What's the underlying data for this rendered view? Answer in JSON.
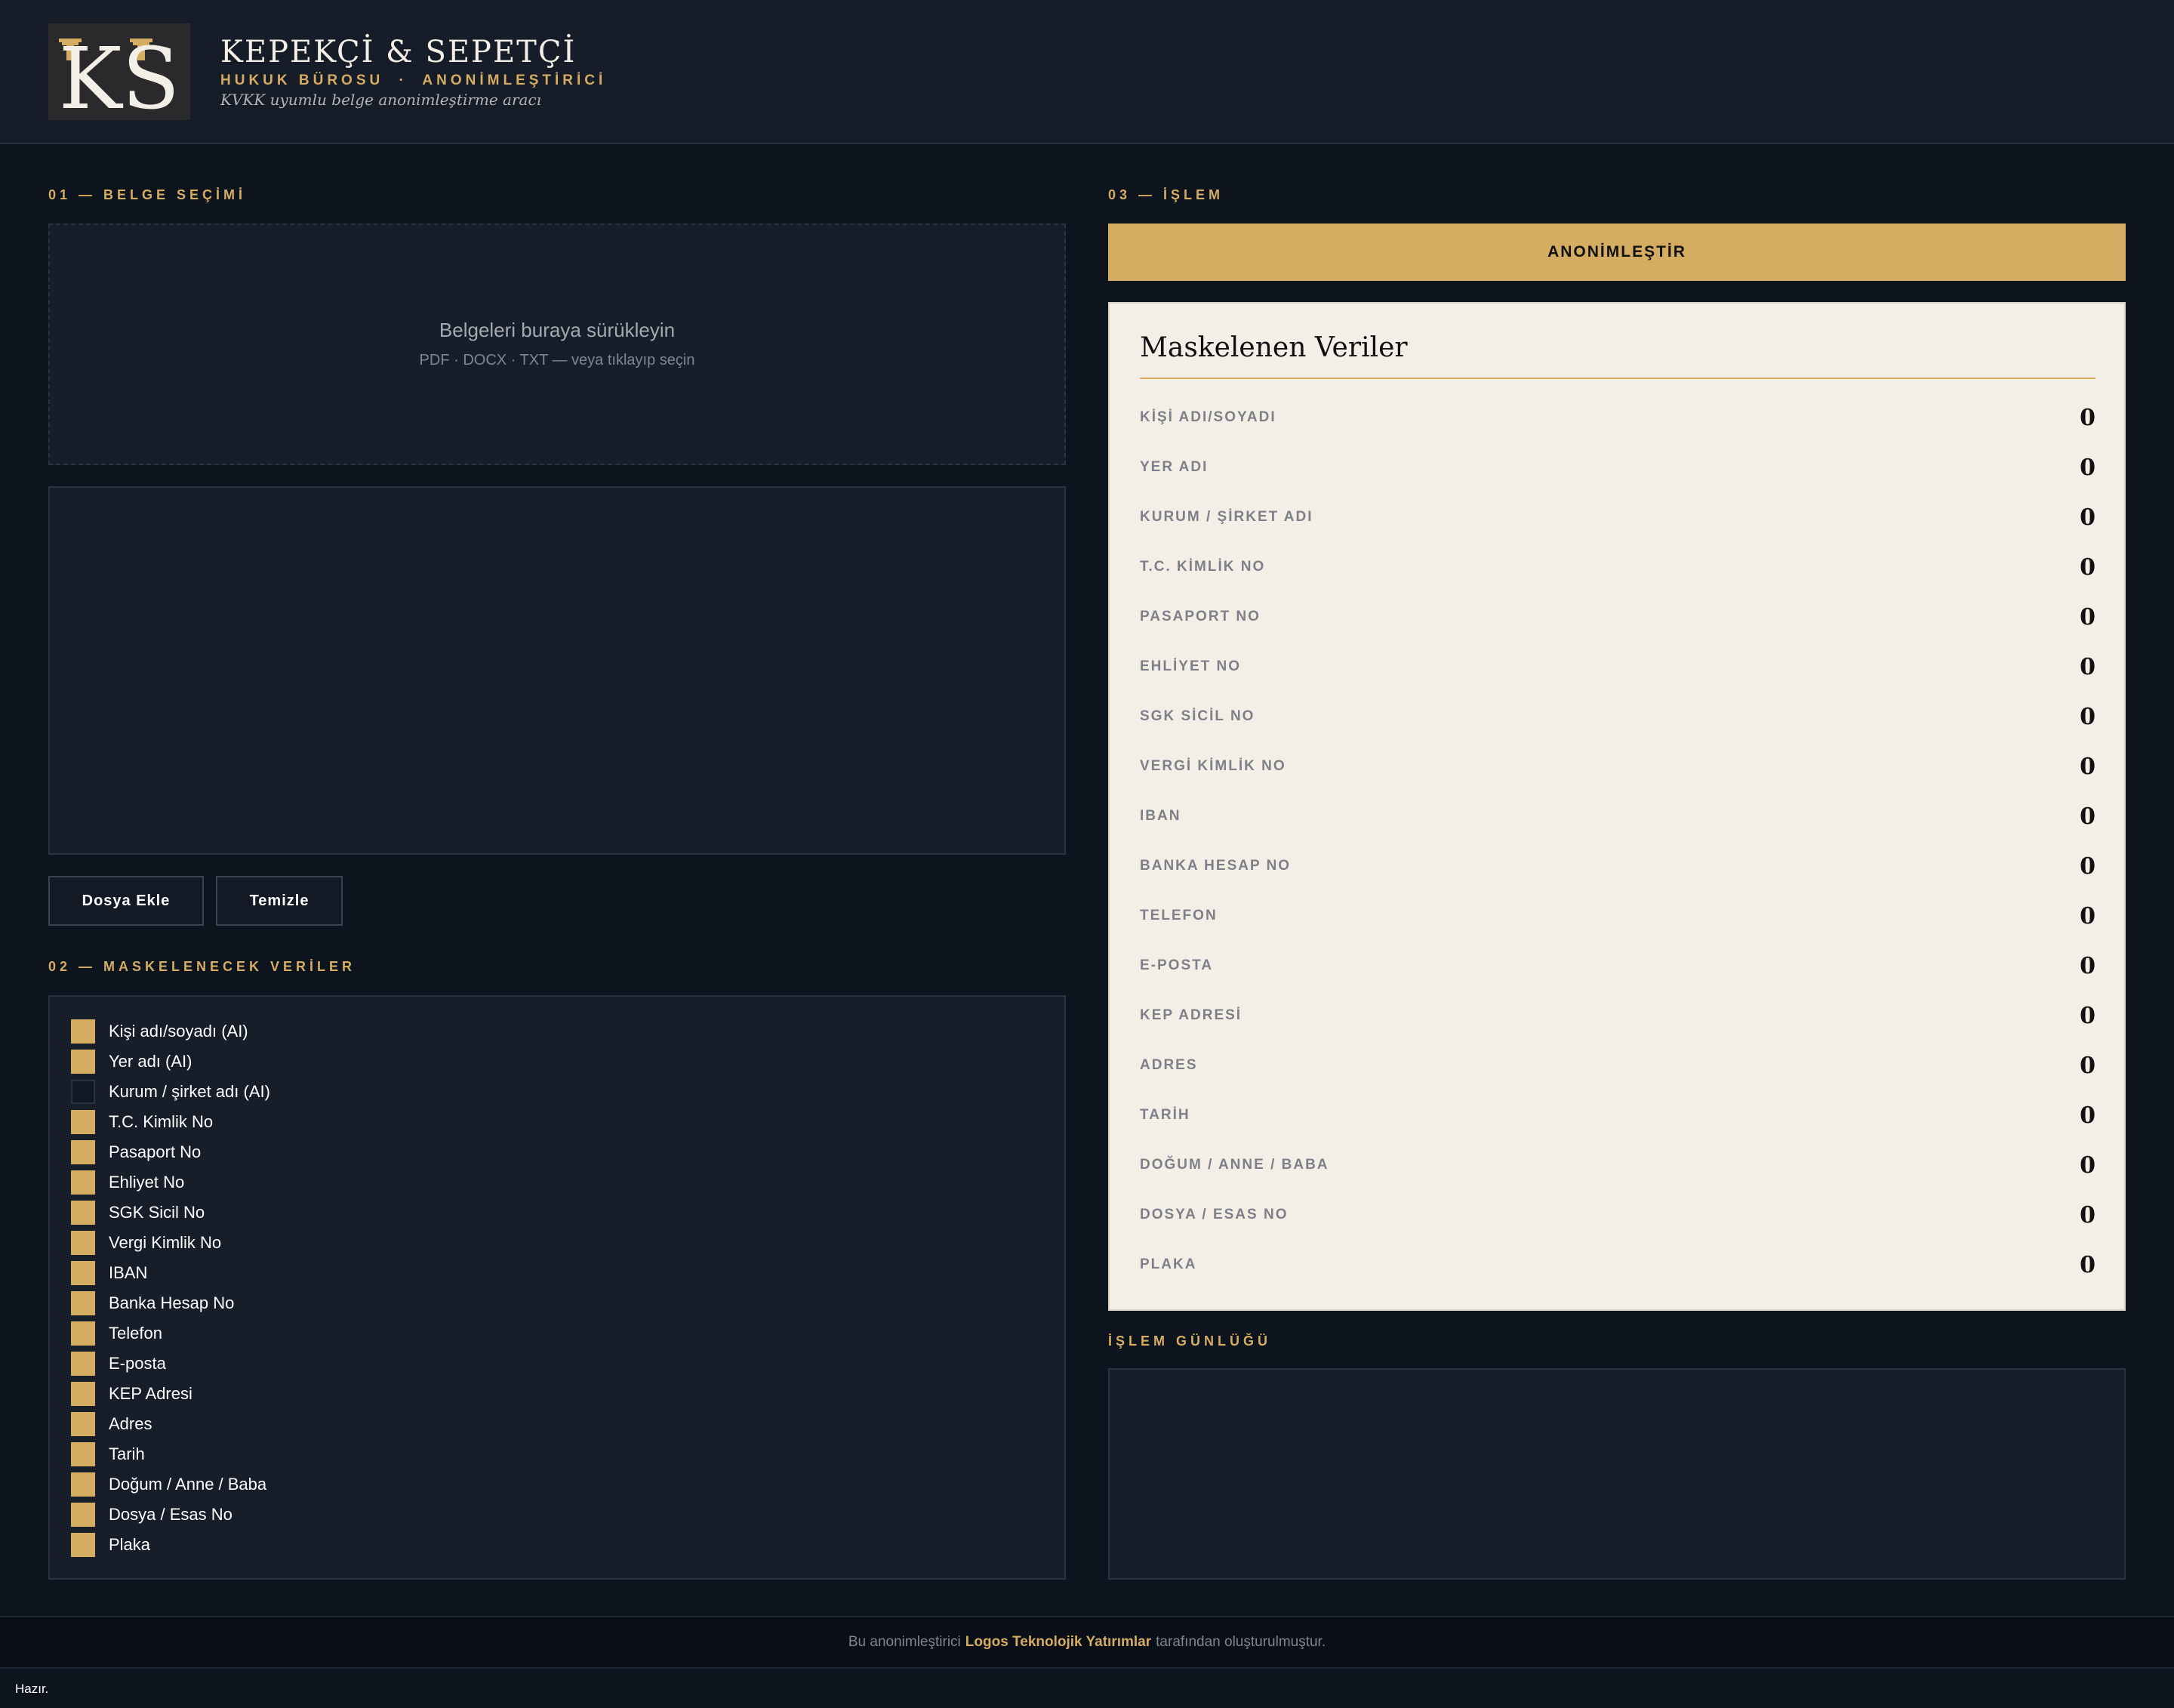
{
  "header": {
    "logo_text": "KS",
    "brand_name": "KEPEKÇİ & SEPETÇİ",
    "brand_sub_left": "HUKUK BÜROSU",
    "brand_sub_sep": "·",
    "brand_sub_right": "ANONİMLEŞTİRİCİ",
    "tagline": "KVKK uyumlu belge anonimleştirme aracı"
  },
  "section1": {
    "label": "01 — BELGE SEÇİMİ",
    "drop_title": "Belgeleri buraya sürükleyin",
    "drop_hint": "PDF · DOCX · TXT  —  veya tıklayıp seçin",
    "add_button": "Dosya Ekle",
    "clear_button": "Temizle"
  },
  "section2": {
    "label": "02 — MASKELENECEK VERİLER",
    "options": [
      {
        "label": "Kişi adı/soyadı  (AI)",
        "checked": true
      },
      {
        "label": "Yer adı  (AI)",
        "checked": true
      },
      {
        "label": "Kurum / şirket adı  (AI)",
        "checked": false
      },
      {
        "label": "T.C. Kimlik No",
        "checked": true
      },
      {
        "label": "Pasaport No",
        "checked": true
      },
      {
        "label": "Ehliyet No",
        "checked": true
      },
      {
        "label": "SGK Sicil No",
        "checked": true
      },
      {
        "label": "Vergi Kimlik No",
        "checked": true
      },
      {
        "label": "IBAN",
        "checked": true
      },
      {
        "label": "Banka Hesap No",
        "checked": true
      },
      {
        "label": "Telefon",
        "checked": true
      },
      {
        "label": "E-posta",
        "checked": true
      },
      {
        "label": "KEP Adresi",
        "checked": true
      },
      {
        "label": "Adres",
        "checked": true
      },
      {
        "label": "Tarih",
        "checked": true
      },
      {
        "label": "Doğum / Anne / Baba",
        "checked": true
      },
      {
        "label": "Dosya / Esas No",
        "checked": true
      },
      {
        "label": "Plaka",
        "checked": true
      }
    ]
  },
  "section3": {
    "label": "03 — İŞLEM",
    "action_button": "ANONİMLEŞTİR",
    "results_title": "Maskelenen Veriler",
    "results": [
      {
        "label": "KİŞİ ADI/SOYADI",
        "value": "0"
      },
      {
        "label": "YER ADI",
        "value": "0"
      },
      {
        "label": "KURUM / ŞİRKET ADI",
        "value": "0"
      },
      {
        "label": "T.C. KİMLİK NO",
        "value": "0"
      },
      {
        "label": "PASAPORT NO",
        "value": "0"
      },
      {
        "label": "EHLİYET NO",
        "value": "0"
      },
      {
        "label": "SGK SİCİL NO",
        "value": "0"
      },
      {
        "label": "VERGİ KİMLİK NO",
        "value": "0"
      },
      {
        "label": "IBAN",
        "value": "0"
      },
      {
        "label": "BANKA HESAP NO",
        "value": "0"
      },
      {
        "label": "TELEFON",
        "value": "0"
      },
      {
        "label": "E-POSTA",
        "value": "0"
      },
      {
        "label": "KEP ADRESİ",
        "value": "0"
      },
      {
        "label": "ADRES",
        "value": "0"
      },
      {
        "label": "TARİH",
        "value": "0"
      },
      {
        "label": "DOĞUM / ANNE / BABA",
        "value": "0"
      },
      {
        "label": "DOSYA / ESAS NO",
        "value": "0"
      },
      {
        "label": "PLAKA",
        "value": "0"
      }
    ],
    "log_label": "İŞLEM GÜNLÜĞÜ"
  },
  "footer": {
    "prefix": "Bu anonimleştirici",
    "company": "Logos Teknolojik Yatırımlar",
    "suffix": "tarafından oluşturulmuştur."
  },
  "status": "Hazır.",
  "colors": {
    "accent": "#d4ad62",
    "background": "#0e141e",
    "panel": "#171d29",
    "results_bg": "#f3efe6"
  }
}
